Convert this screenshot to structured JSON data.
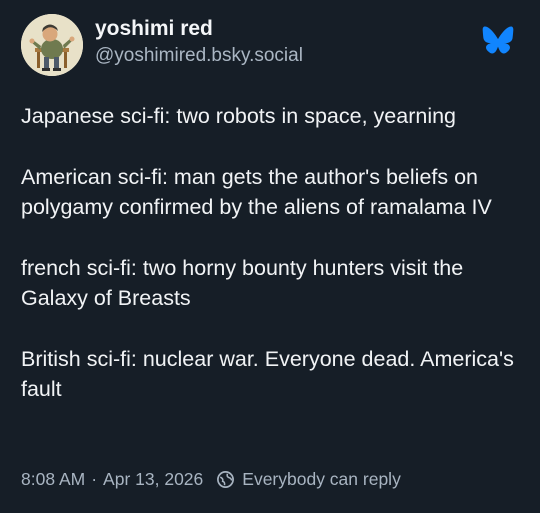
{
  "author": {
    "display_name": "yoshimi red",
    "handle": "@yoshimired.bsky.social",
    "avatar_icon": "avatar-illustration"
  },
  "brand": {
    "icon": "butterfly-icon",
    "color": "#1185fe"
  },
  "post": {
    "paragraphs": [
      "Japanese sci-fi: two robots in space, yearning",
      "American sci-fi: man gets the author's beliefs on polygamy confirmed by the aliens of ramalama IV",
      "french sci-fi: two horny bounty hunters visit the Galaxy of Breasts",
      "British sci-fi: nuclear war. Everyone dead. America's fault"
    ]
  },
  "meta": {
    "time": "8:08 AM",
    "separator": "·",
    "date": "Apr 13, 2026",
    "reply_setting_icon": "globe-reply-icon",
    "reply_setting": "Everybody can reply"
  },
  "colors": {
    "background": "#161e27",
    "text": "#f1f3f5",
    "muted": "#a8b4c1"
  }
}
